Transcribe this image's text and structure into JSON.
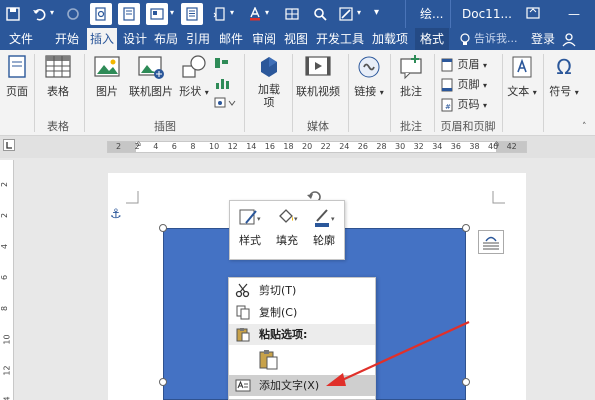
{
  "window": {
    "title_truncated": "绘...",
    "doc_title": "Doc11...",
    "minimize_glyph": "—"
  },
  "qat": {
    "icons": [
      "save-icon",
      "undo-icon",
      "redo-icon",
      "print-preview-icon",
      "page-layout-icon",
      "paragraph-icon",
      "position-icon",
      "font-color-icon",
      "table-icon",
      "find-icon",
      "draw-icon",
      "more-icon"
    ]
  },
  "tabs": [
    {
      "label": "文件"
    },
    {
      "label": "开始"
    },
    {
      "label": "插入"
    },
    {
      "label": "设计"
    },
    {
      "label": "布局"
    },
    {
      "label": "引用"
    },
    {
      "label": "邮件"
    },
    {
      "label": "审阅"
    },
    {
      "label": "视图"
    },
    {
      "label": "开发工具"
    },
    {
      "label": "加载项"
    },
    {
      "label": "格式"
    }
  ],
  "tellme": "告诉我...",
  "signin": "登录",
  "share_glyph": "Ω",
  "ribbon": {
    "pages": "页面",
    "table": "表格",
    "table_group": "表格",
    "picture": "图片",
    "online_picture": "联机图片",
    "shapes": "形状",
    "illustrations_group": "插图",
    "addins": "加载\n项",
    "online_video": "联机视频",
    "media_group": "媒体",
    "link": "链接",
    "comment": "批注",
    "comment_group": "批注",
    "header": "页眉",
    "footer": "页脚",
    "page_number": "页码",
    "header_footer_group": "页眉和页脚",
    "text": "文本",
    "symbol": "符号"
  },
  "ruler": {
    "ticks": [
      "2",
      "2",
      "4",
      "6",
      "8",
      "10",
      "12",
      "14",
      "16",
      "18",
      "20",
      "22",
      "24",
      "26",
      "28",
      "30",
      "32",
      "34",
      "36",
      "38",
      "40",
      "42"
    ]
  },
  "vruler": {
    "ticks": [
      "2",
      "2",
      "4",
      "6",
      "8",
      "10",
      "12",
      "14"
    ]
  },
  "minibar": {
    "style": "样式",
    "fill": "填充",
    "outline": "轮廓"
  },
  "context_menu": {
    "cut": "剪切(T)",
    "copy": "复制(C)",
    "paste_options": "粘贴选项:",
    "add_text": "添加文字(X)"
  },
  "colors": {
    "brand": "#2b579a",
    "shape_fill": "#4472c4",
    "arrow": "#e0302a"
  }
}
